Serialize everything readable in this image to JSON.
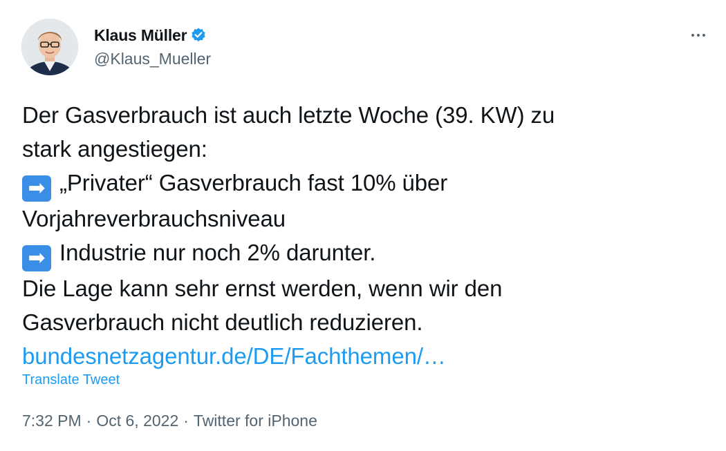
{
  "author": {
    "display_name": "Klaus Müller",
    "handle": "@Klaus_Mueller",
    "verified": true,
    "verified_color": "#1d9bf0"
  },
  "tweet": {
    "lines": [
      "Der Gasverbrauch ist auch letzte Woche (39. KW) zu",
      "stark angestiegen:",
      "„Privater“ Gasverbrauch fast 10% über",
      "Vorjahreverbrauchsniveau",
      "Industrie nur noch 2% darunter.",
      "Die Lage kann sehr ernst werden, wenn wir den",
      "Gasverbrauch nicht deutlich reduzieren."
    ],
    "emoji": "➡",
    "link_text": "bundesnetzagentur.de/DE/Fachthemen/…"
  },
  "translate_label": "Translate Tweet",
  "meta": {
    "time": "7:32 PM",
    "separator": "·",
    "date": "Oct 6, 2022",
    "source": "Twitter for iPhone"
  },
  "icons": {
    "more": "more-options-icon",
    "verified": "verified-badge-icon",
    "arrow": "right-arrow-emoji"
  },
  "colors": {
    "text": "#0f1419",
    "secondary": "#536471",
    "link": "#1d9bf0",
    "emoji_bg": "#3a8ee6"
  }
}
